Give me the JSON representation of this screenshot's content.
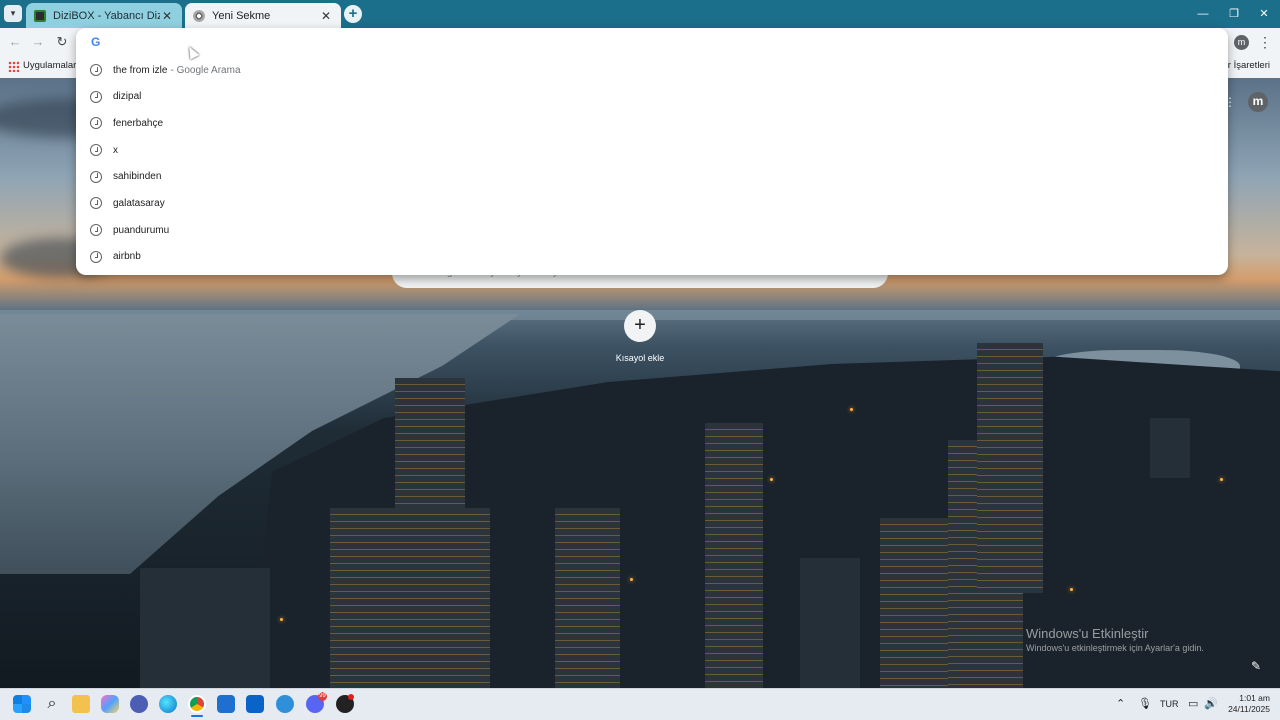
{
  "browser": {
    "tabs": [
      {
        "title": "DiziBOX - Yabancı Dizi izle, Yabancı",
        "active": false
      },
      {
        "title": "Yeni Sekme",
        "active": true
      }
    ],
    "toolbar": {
      "profile_initial": "m"
    },
    "bookmarks": {
      "apps_label": "Uygulamalar",
      "all_bookmarks_label": "Tüm Yer İşaretleri"
    }
  },
  "omnibox": {
    "value": "",
    "suggestions": [
      {
        "text": "the from izle",
        "suffix": "- Google Arama"
      },
      {
        "text": "dizipal",
        "suffix": ""
      },
      {
        "text": "fenerbahçe",
        "suffix": ""
      },
      {
        "text": "x",
        "suffix": ""
      },
      {
        "text": "sahibinden",
        "suffix": ""
      },
      {
        "text": "galatasaray",
        "suffix": ""
      },
      {
        "text": "puandurumu",
        "suffix": ""
      },
      {
        "text": "airbnb",
        "suffix": ""
      }
    ]
  },
  "ntp": {
    "profile_initial": "m",
    "search_placeholder": "Google'da arayın veya URL yazın",
    "shortcut_label": "Kısayol ekle",
    "activation_title": "Windows'u Etkinleştir",
    "activation_sub": "Windows'u etkinleştirmek için Ayarlar'a gidin."
  },
  "taskbar": {
    "language": "TUR",
    "time": "1:01 am",
    "date": "24/11/2025",
    "discord_badge": "99"
  },
  "colors": {
    "tabstrip": "#1b6f8a",
    "accent": "#1a73e8"
  }
}
